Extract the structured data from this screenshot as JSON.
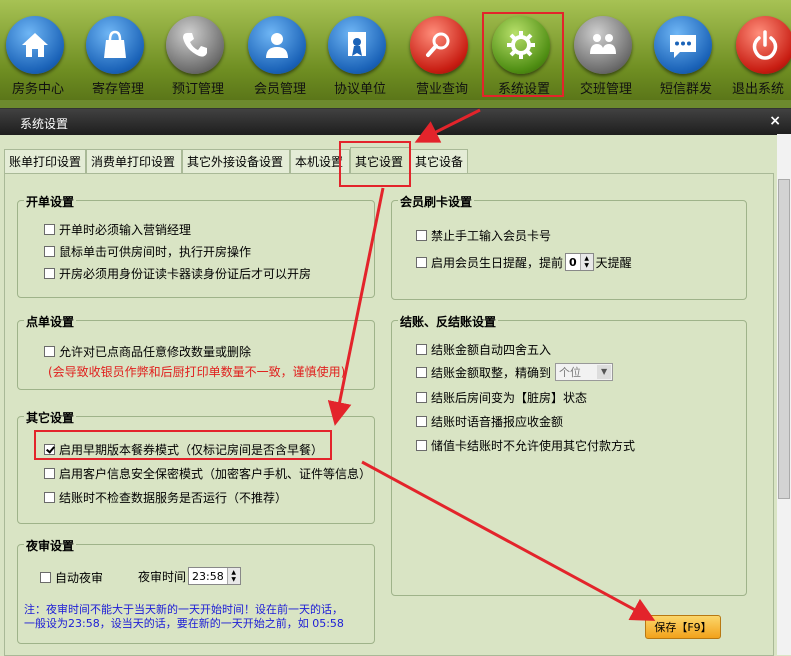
{
  "toolbar": {
    "items": [
      {
        "label": "房务中心",
        "icon": "house-icon"
      },
      {
        "label": "寄存管理",
        "icon": "bag-icon"
      },
      {
        "label": "预订管理",
        "icon": "phone-icon"
      },
      {
        "label": "会员管理",
        "icon": "person-icon"
      },
      {
        "label": "协议单位",
        "icon": "certificate-icon"
      },
      {
        "label": "营业查询",
        "icon": "magnifier-icon"
      },
      {
        "label": "系统设置",
        "icon": "gear-icon"
      },
      {
        "label": "交班管理",
        "icon": "handover-icon"
      },
      {
        "label": "短信群发",
        "icon": "message-icon"
      },
      {
        "label": "退出系统",
        "icon": "power-icon"
      }
    ]
  },
  "dialog": {
    "title": "系统设置",
    "close": "×",
    "tabs": [
      "账单打印设置",
      "消费单打印设置",
      "其它外接设备设置",
      "本机设置",
      "其它设置",
      "其它设备"
    ],
    "active_tab": "其它设置"
  },
  "groups": {
    "open_bill": {
      "title": "开单设置",
      "options": [
        {
          "label": "开单时必须输入营销经理",
          "checked": false
        },
        {
          "label": "鼠标单击可供房间时，执行开房操作",
          "checked": false
        },
        {
          "label": "开房必须用身份证读卡器读身份证后才可以开房",
          "checked": false
        }
      ]
    },
    "order": {
      "title": "点单设置",
      "option": {
        "label": "允许对已点商品任意修改数量或删除",
        "checked": false
      },
      "warning": "(会导致收银员作弊和后厨打印单数量不一致，谨慎使用)"
    },
    "other": {
      "title": "其它设置",
      "options": [
        {
          "label": "启用早期版本餐券模式（仅标记房间是否含早餐）",
          "checked": true
        },
        {
          "label": "启用客户信息安全保密模式（加密客户手机、证件等信息）",
          "checked": false
        },
        {
          "label": "结账时不检查数据服务是否运行（不推荐）",
          "checked": false
        }
      ]
    },
    "night_audit": {
      "title": "夜审设置",
      "auto_label": "自动夜审",
      "auto_checked": false,
      "time_label": "夜审时间",
      "time_value": "23:58",
      "note_line1": "注：夜审时间不能大于当天新的一天开始时间！设在前一天的话，",
      "note_line2": "一般设为23:58，设当天的话，要在新的一天开始之前，如 05:58"
    },
    "member_card": {
      "title": "会员刷卡设置",
      "opt1": "禁止手工输入会员卡号",
      "opt2_prefix": "启用会员生日提醒，提前",
      "opt2_value": "0",
      "opt2_suffix": "天提醒"
    },
    "checkout": {
      "title": "结账、反结账设置",
      "opt1": "结账金额自动四舍五入",
      "opt2_prefix": "结账金额取整，精确到",
      "opt2_select": "个位",
      "opt3": "结账后房间变为【脏房】状态",
      "opt4": "结账时语音播报应收金额",
      "opt5": "储值卡结账时不允许使用其它付款方式"
    }
  },
  "save_button": "保存【F9】",
  "colors": {
    "highlight": "#e3242b",
    "panel_bg": "#d9e4c4",
    "toolbar_green": "#6f8e22"
  }
}
